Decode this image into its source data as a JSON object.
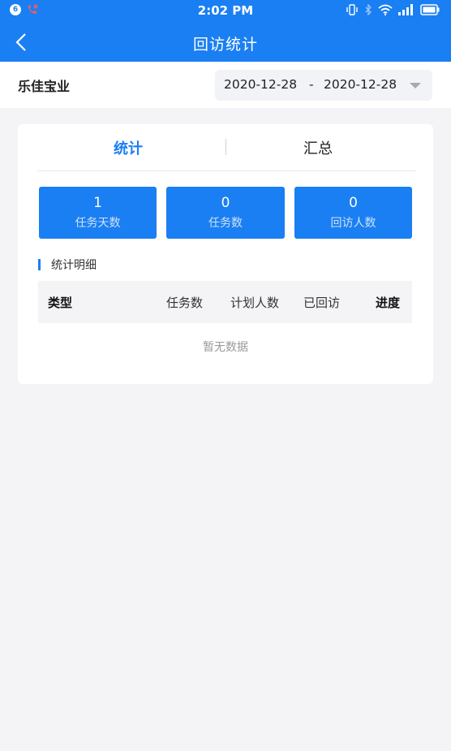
{
  "status_bar": {
    "notification_count": "6",
    "time": "2:02 PM"
  },
  "header": {
    "title": "回访统计"
  },
  "filter": {
    "company": "乐佳宝业",
    "date_start": "2020-12-28",
    "date_separator": "-",
    "date_end": "2020-12-28"
  },
  "tabs": [
    {
      "label": "统计",
      "active": true
    },
    {
      "label": "汇总",
      "active": false
    }
  ],
  "stats": [
    {
      "value": "1",
      "label": "任务天数"
    },
    {
      "value": "0",
      "label": "任务数"
    },
    {
      "value": "0",
      "label": "回访人数"
    }
  ],
  "detail": {
    "section_title": "统计明细",
    "columns": [
      "类型",
      "任务数",
      "计划人数",
      "已回访",
      "进度"
    ],
    "empty_text": "暂无数据"
  },
  "colors": {
    "primary": "#1a7ff2",
    "background": "#f4f4f6"
  }
}
